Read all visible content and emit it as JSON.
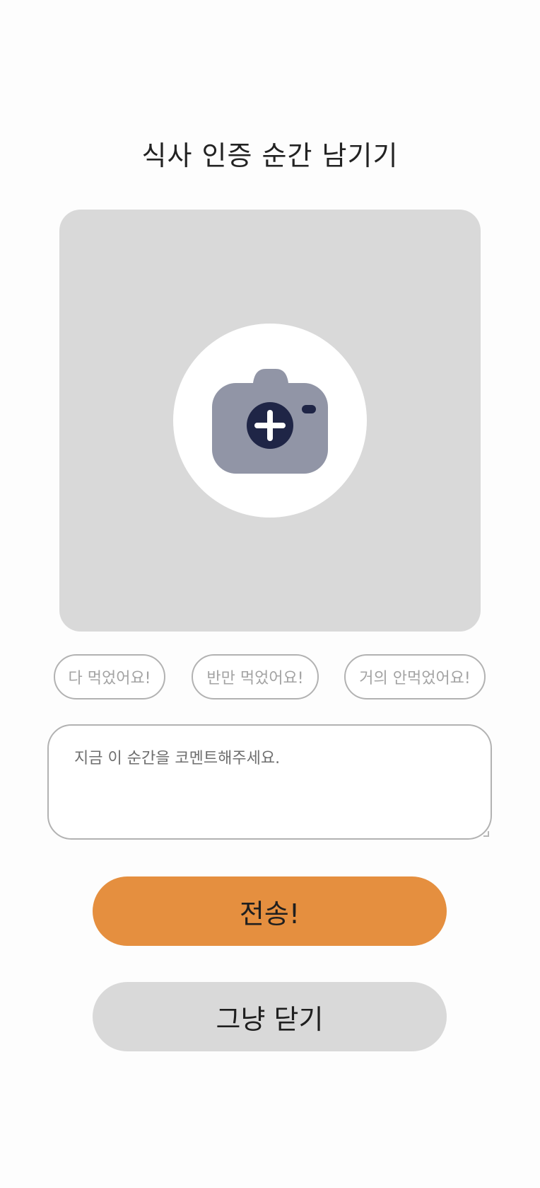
{
  "header": {
    "title": "식사 인증 순간 남기기"
  },
  "photo_upload": {
    "icon": "camera-add-icon",
    "background_color": "#d9d9d9",
    "icon_color": "#9195a6",
    "icon_accent_color": "#1f2546"
  },
  "meal_status": {
    "options": [
      {
        "label": "다 먹었어요!"
      },
      {
        "label": "반만 먹었어요!"
      },
      {
        "label": "거의 안먹었어요!"
      }
    ]
  },
  "comment": {
    "value": "",
    "placeholder": "지금 이 순간을 코멘트해주세요."
  },
  "actions": {
    "send_label": "전송!",
    "send_color": "#e58f3f",
    "close_label": "그냥 닫기",
    "close_color": "#d9d9d9"
  }
}
